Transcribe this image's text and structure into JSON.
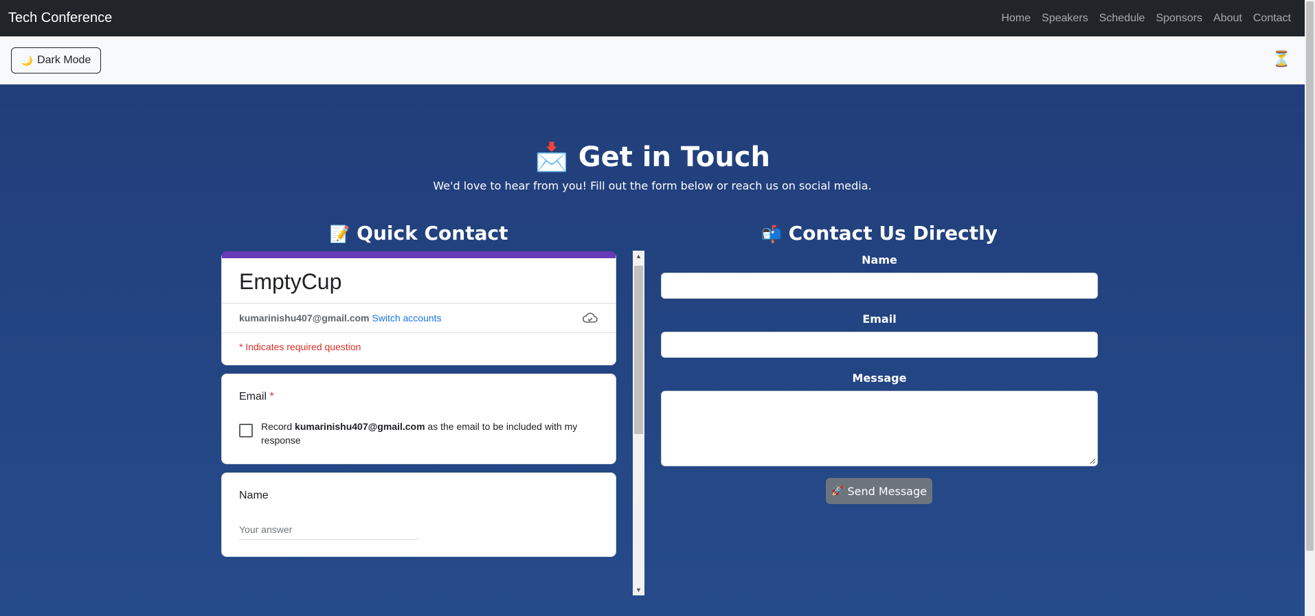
{
  "navbar": {
    "brand": "Tech Conference",
    "links": [
      "Home",
      "Speakers",
      "Schedule",
      "Sponsors",
      "About",
      "Contact"
    ]
  },
  "toolbar": {
    "dark_mode_icon": "🌙",
    "dark_mode_label": "Dark Mode",
    "hourglass_icon": "⏳"
  },
  "hero": {
    "title_icon": "📩",
    "title": "Get in Touch",
    "subtitle": "We'd love to hear from you! Fill out the form below or reach us on social media."
  },
  "quick_contact": {
    "heading_icon": "📝",
    "heading": "Quick Contact",
    "form": {
      "title": "EmptyCup",
      "account_email": "kumarinishu407@gmail.com",
      "switch_label": "Switch accounts",
      "required_note": "* Indicates required question",
      "email_question": "Email",
      "required_star": "*",
      "record_prefix": "Record ",
      "record_email": "kumarinishu407@gmail.com",
      "record_suffix": " as the email to be included with my response",
      "name_question": "Name",
      "answer_placeholder": "Your answer"
    }
  },
  "direct_contact": {
    "heading_icon": "📬",
    "heading": "Contact Us Directly",
    "name_label": "Name",
    "email_label": "Email",
    "message_label": "Message",
    "send_icon": "🚀",
    "send_label": "Send Message"
  }
}
